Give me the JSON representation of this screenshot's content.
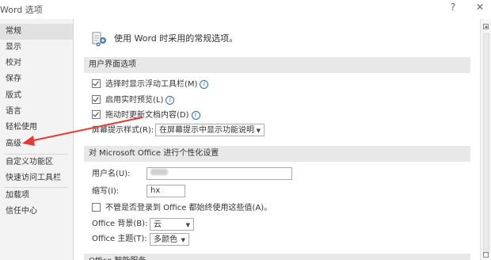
{
  "window": {
    "title": "Word 选项",
    "help_label": "?",
    "close_label": "✕"
  },
  "sidebar": {
    "items": [
      {
        "label": "常规"
      },
      {
        "label": "显示"
      },
      {
        "label": "校对"
      },
      {
        "label": "保存"
      },
      {
        "label": "版式"
      },
      {
        "label": "语言"
      },
      {
        "label": "轻松使用"
      },
      {
        "label": "高级"
      },
      {
        "label": "自定义功能区"
      },
      {
        "label": "快速访问工具栏"
      },
      {
        "label": "加载项"
      },
      {
        "label": "信任中心"
      }
    ],
    "active": "常规"
  },
  "main": {
    "header_text": "使用 Word 时采用的常规选项。",
    "ui_section": {
      "title": "用户界面选项",
      "checkboxes": [
        {
          "label": "选择时显示浮动工具栏(M)",
          "checked": true
        },
        {
          "label": "启用实时预览(L)",
          "checked": true
        },
        {
          "label": "拖动时更新文档内容(D)",
          "checked": true
        }
      ],
      "tooltip_style": {
        "label": "屏幕提示样式(R):",
        "value": "在屏幕提示中显示功能说明"
      }
    },
    "personalize_section": {
      "title": "对 Microsoft Office 进行个性化设置",
      "username_label": "用户名(U):",
      "initials_label": "缩写(I):",
      "initials_value": "hx",
      "always_use_label": "不管是否登录到 Office 都始终使用这些值(A)。",
      "always_use_checked": false,
      "background_label": "Office 背景(B):",
      "background_value": "云",
      "theme_label": "Office 主题(T):",
      "theme_value": "多颜色"
    },
    "partial_section_title": "Office 智能服务"
  },
  "colors": {
    "annotation_arrow": "#e53935",
    "info_icon": "#2b6cb0"
  }
}
